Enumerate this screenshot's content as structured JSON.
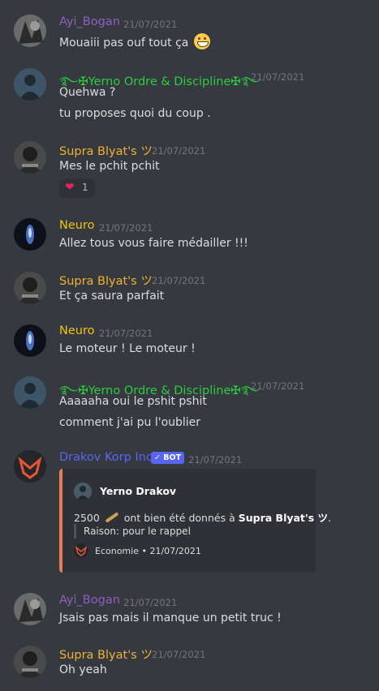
{
  "colors": {
    "background": "#36393f",
    "timestamp": "#72767d",
    "text": "#dcddde",
    "ayi": "#8e5ec2",
    "yerno": "#2ecc40",
    "supra": "#f0b232",
    "neuro": "#f1c40f",
    "drakov": "#5865f2",
    "embed_accent": "#e67e54"
  },
  "messages": [
    {
      "author": "Ayi_Bogan",
      "time": "21/07/2021",
      "lines": [
        "Mouaiii pas ouf tout ça"
      ],
      "emoji": "grinning-face"
    },
    {
      "author": "࿐✠Yerno Ordre & Discipline✠࿐",
      "time": "21/07/2021",
      "lines": [
        "Quehwa ?",
        "tu proposes quoi du coup ."
      ]
    },
    {
      "author": "Supra Blyat's ツ",
      "time": "21/07/2021",
      "lines": [
        "Mes le pchit pchit"
      ],
      "reaction": {
        "emoji": "❤",
        "count": "1"
      }
    },
    {
      "author": "Neuro",
      "time": "21/07/2021",
      "lines": [
        "Allez tous vous faire médailler !!!"
      ]
    },
    {
      "author": "Supra Blyat's ツ",
      "time": "21/07/2021",
      "lines": [
        "Et ça saura parfait"
      ]
    },
    {
      "author": "Neuro",
      "time": "21/07/2021",
      "lines": [
        "Le moteur ! Le moteur !"
      ]
    },
    {
      "author": "࿐✠Yerno Ordre & Discipline✠࿐",
      "time": "21/07/2021",
      "lines": [
        "Aaaaaha oui le pshit pshit",
        "comment j'ai pu l'oublier"
      ]
    },
    {
      "author": "Drakov Korp Inc",
      "tag": "✓ BOT",
      "time": "21/07/2021",
      "embed": {
        "author": "Yerno Drakov",
        "amount": "2500",
        "desc_middle": "ont bien été donnés à",
        "recipient": "Supra Blyat's ツ",
        "desc_end": ".",
        "reason": "Raison: pour le rappel",
        "footer": "Economie • 21/07/2021"
      }
    },
    {
      "author": "Ayi_Bogan",
      "time": "21/07/2021",
      "lines": [
        "Jsais pas mais il manque un petit truc !"
      ]
    },
    {
      "author": "Supra Blyat's ツ",
      "time": "21/07/2021",
      "lines": [
        "Oh yeah"
      ]
    }
  ]
}
